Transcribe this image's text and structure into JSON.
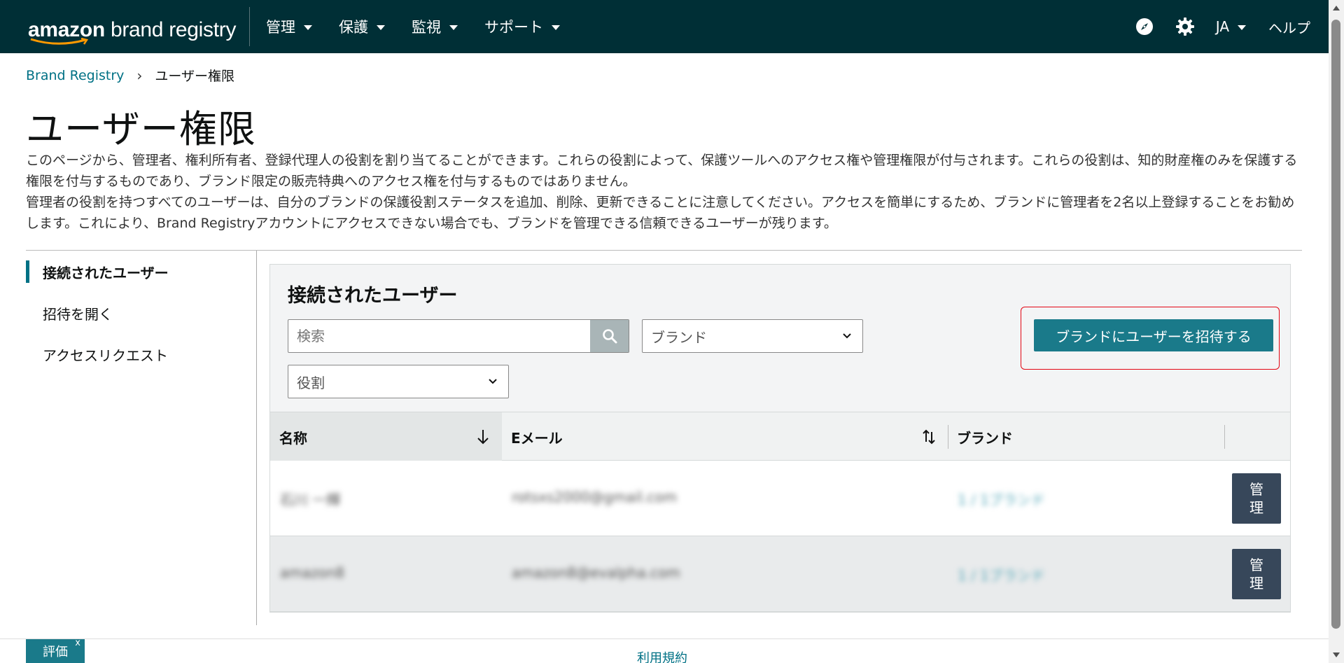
{
  "app": {
    "logo_prefix": "amazon",
    "logo_suffix": " brand registry"
  },
  "nav": {
    "menus": [
      {
        "label": "管理"
      },
      {
        "label": "保護"
      },
      {
        "label": "監視"
      },
      {
        "label": "サポート"
      }
    ],
    "lang": "JA",
    "help": "ヘルプ"
  },
  "breadcrumb": {
    "root": "Brand Registry",
    "separator": "›",
    "current": "ユーザー権限"
  },
  "page": {
    "title": "ユーザー権限",
    "description_1": "このページから、管理者、権利所有者、登録代理人の役割を割り当てることができます。これらの役割によって、保護ツールへのアクセス権や管理権限が付与されます。これらの役割は、知的財産権のみを保護する権限を付与するものであり、ブランド限定の販売特典へのアクセス権を付与するものではありません。",
    "description_2": "管理者の役割を持つすべてのユーザーは、自分のブランドの保護役割ステータスを追加、削除、更新できることに注意してください。アクセスを簡単にするため、ブランドに管理者を2名以上登録することをお勧めします。これにより、Brand Registryアカウントにアクセスできない場合でも、ブランドを管理できる信頼できるユーザーが残ります。"
  },
  "sidenav": {
    "items": [
      {
        "label": "接続されたユーザー"
      },
      {
        "label": "招待を開く"
      },
      {
        "label": "アクセスリクエスト"
      }
    ]
  },
  "panel": {
    "title": "接続されたユーザー",
    "search_placeholder": "検索",
    "brand_select": "ブランド",
    "role_select": "役割",
    "invite_label": "ブランドにユーザーを招待する"
  },
  "table": {
    "headers": {
      "name": "名称",
      "email": "Eメール",
      "brand": "ブランド"
    },
    "rows": [
      {
        "name": "石川 一輝",
        "email": "rotsxs2000@gmail.com",
        "brand": "1 / 1ブランド",
        "action": "管理"
      },
      {
        "name": "amazon8",
        "email": "amazon8@evalpha.com",
        "brand": "1 / 1ブランド",
        "action": "管理"
      }
    ]
  },
  "footer": {
    "feedback": "評価",
    "feedback_close": "x",
    "terms": "利用規約"
  },
  "colors": {
    "nav_bg": "#002f36",
    "accent": "#1a7a8a",
    "link": "#007185",
    "highlight_border": "#e30613"
  }
}
